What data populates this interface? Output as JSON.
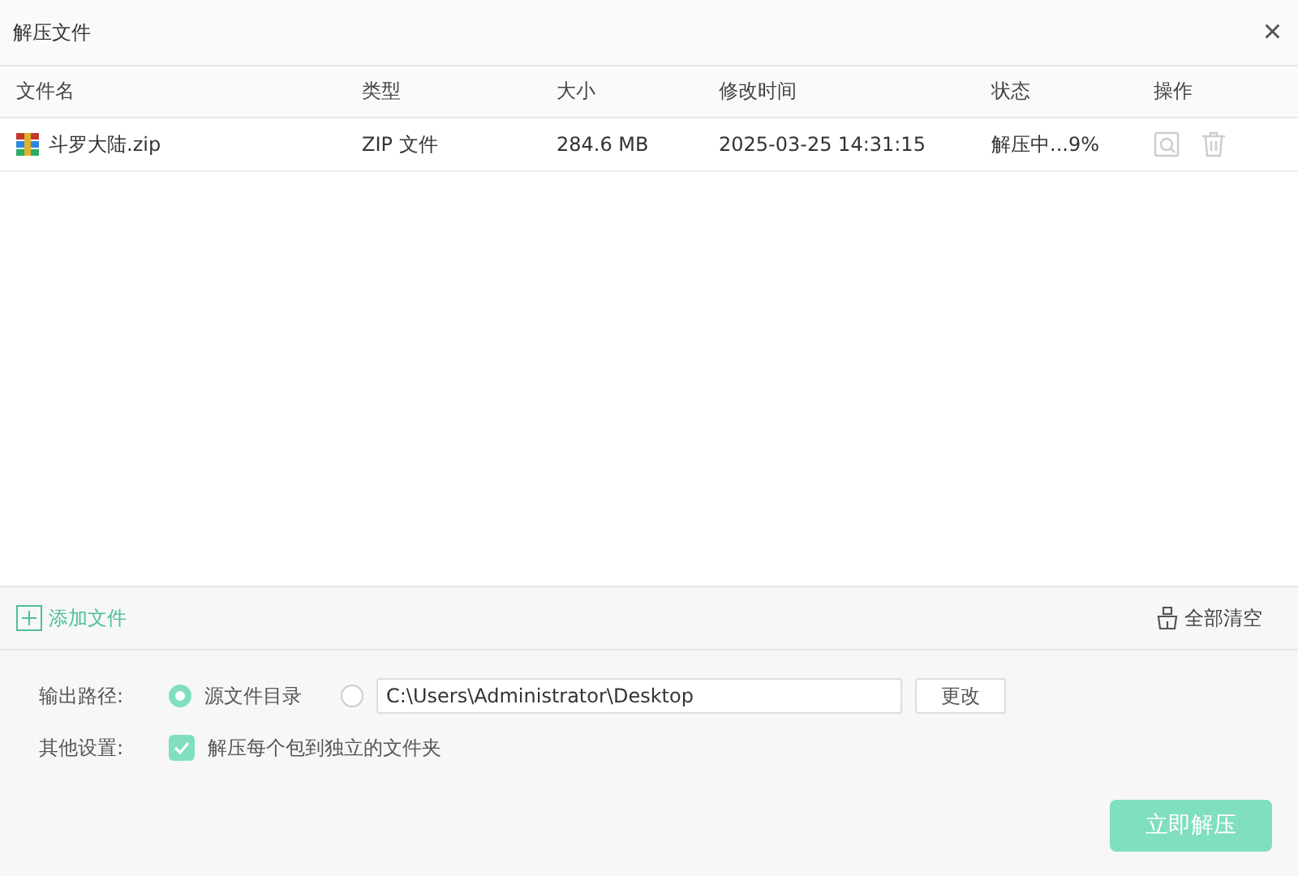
{
  "window": {
    "title": "解压文件",
    "close": "×"
  },
  "table": {
    "columns": [
      "文件名",
      "类型",
      "大小",
      "修改时间",
      "状态",
      "操作"
    ],
    "rows": [
      {
        "name": "斗罗大陆.zip",
        "type": "ZIP 文件",
        "size": "284.6 MB",
        "modified": "2025-03-25 14:31:15",
        "status": "解压中...9%"
      }
    ]
  },
  "toolbar": {
    "add": "添加文件",
    "clear": "全部清空"
  },
  "output_path": {
    "label": "输出路径:",
    "options": [
      {
        "kind": "source",
        "label": "源文件目录",
        "selected": true
      },
      {
        "kind": "custom",
        "value": "C:\\Users\\Administrator\\Desktop",
        "selected": false
      }
    ],
    "change_button": "更改"
  },
  "other_settings": {
    "label": "其他设置:",
    "checkbox": {
      "label": "解压每个包到独立的文件夹",
      "checked": true
    }
  },
  "primary_button": "立即解压"
}
